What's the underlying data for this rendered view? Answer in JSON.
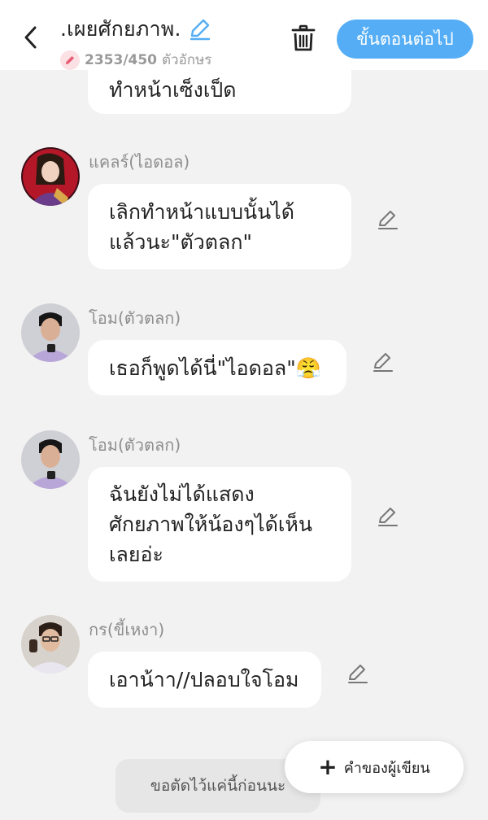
{
  "header": {
    "back_icon": "chevron-left-icon",
    "title": ".เผยศักยภาพ.",
    "title_edit_icon": "pencil-icon",
    "char_count": "2353/450",
    "char_unit": "ตัวอักษร",
    "trash_icon": "trash-icon",
    "next_label": "ขั้นตอนต่อไป",
    "accent_color": "#55aef5"
  },
  "messages": [
    {
      "lines": [
        "ทำหน้าเซ็งเป็ด"
      ],
      "partial": true
    },
    {
      "name": "แคลร์(ไอดอล)",
      "lines": [
        "เลิกทำหน้าแบบนั้นได้",
        "แล้วนะ\"ตัวตลก\""
      ],
      "avatar": "avatar-claire"
    },
    {
      "name": "โอม(ตัวตลก)",
      "lines": [
        "เธอก็พูดได้นี่\"ไอดอล\"😤"
      ],
      "avatar": "avatar-om"
    },
    {
      "name": "โอม(ตัวตลก)",
      "lines": [
        "ฉันยังไม่ได้แสดง",
        "ศักยภาพให้น้องๆได้เห็น",
        "เลยอ่ะ"
      ],
      "avatar": "avatar-om"
    },
    {
      "name": "กร(ขี้เหงา)",
      "lines": [
        "เอาน้าา//ปลอบใจโอม"
      ],
      "avatar": "avatar-korn"
    }
  ],
  "footer": {
    "cut_label": "ขอตัดไว้แค่นี้ก่อนนะ",
    "writer_plus": "+",
    "writer_label": "คำของผู้เขียน"
  }
}
